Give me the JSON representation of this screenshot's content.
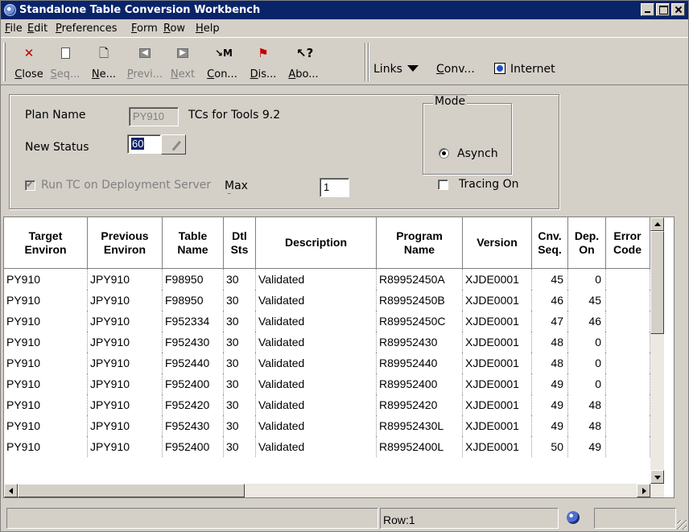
{
  "window": {
    "title": "Standalone Table Conversion Workbench"
  },
  "menu": [
    "File",
    "Edit",
    "Preferences",
    "Form",
    "Row",
    "Help"
  ],
  "toolbar": {
    "buttons": [
      {
        "label": "Close",
        "icon": "close-x-icon",
        "enabled": true
      },
      {
        "label": "Seq...",
        "icon": "document-icon",
        "enabled": false
      },
      {
        "label": "Ne...",
        "icon": "new-document-icon",
        "enabled": true
      },
      {
        "label": "Previ...",
        "icon": "previous-arrow-icon",
        "enabled": false
      },
      {
        "label": "Next",
        "icon": "next-arrow-icon",
        "enabled": false
      },
      {
        "label": "Con...",
        "icon": "conversion-icon",
        "enabled": true
      },
      {
        "label": "Dis...",
        "icon": "display-icon",
        "enabled": true
      },
      {
        "label": "Abo...",
        "icon": "about-help-icon",
        "enabled": true
      }
    ],
    "links_label": "Links",
    "conv_label": "Conv...",
    "internet_label": "Internet"
  },
  "form": {
    "plan_name_label": "Plan Name",
    "plan_name_value": "PY910",
    "plan_description": "TCs for Tools 9.2",
    "new_status_label": "New Status",
    "new_status_value": "60",
    "run_tc_label": "Run TC on Deployment Server",
    "run_tc_checked": true,
    "max_concurrent_label": "Max Concurrent",
    "max_concurrent_value": "1",
    "mode_label": "Mode",
    "mode_option": "Asynch",
    "tracing_label": "Tracing On",
    "tracing_checked": false
  },
  "grid": {
    "columns": [
      "Target\nEnviron",
      "Previous\nEnviron",
      "Table\nName",
      "Dtl\nSts",
      "Description",
      "Program\nName",
      "Version",
      "Cnv.\nSeq.",
      "Dep.\nOn",
      "Error\nCode"
    ],
    "rows": [
      [
        "PY910",
        "JPY910",
        "F98950",
        "30",
        "Validated",
        "R89952450A",
        "XJDE0001",
        "45",
        "0",
        ""
      ],
      [
        "PY910",
        "JPY910",
        "F98950",
        "30",
        "Validated",
        "R89952450B",
        "XJDE0001",
        "46",
        "45",
        ""
      ],
      [
        "PY910",
        "JPY910",
        "F952334",
        "30",
        "Validated",
        "R89952450C",
        "XJDE0001",
        "47",
        "46",
        ""
      ],
      [
        "PY910",
        "JPY910",
        "F952430",
        "30",
        "Validated",
        "R89952430",
        "XJDE0001",
        "48",
        "0",
        ""
      ],
      [
        "PY910",
        "JPY910",
        "F952440",
        "30",
        "Validated",
        "R89952440",
        "XJDE0001",
        "48",
        "0",
        ""
      ],
      [
        "PY910",
        "JPY910",
        "F952400",
        "30",
        "Validated",
        "R89952400",
        "XJDE0001",
        "49",
        "0",
        ""
      ],
      [
        "PY910",
        "JPY910",
        "F952420",
        "30",
        "Validated",
        "R89952420",
        "XJDE0001",
        "49",
        "48",
        ""
      ],
      [
        "PY910",
        "JPY910",
        "F952430",
        "30",
        "Validated",
        "R89952430L",
        "XJDE0001",
        "49",
        "48",
        ""
      ],
      [
        "PY910",
        "JPY910",
        "F952400",
        "30",
        "Validated",
        "R89952400L",
        "XJDE0001",
        "50",
        "49",
        ""
      ]
    ]
  },
  "status": {
    "row_text": "Row:1"
  }
}
